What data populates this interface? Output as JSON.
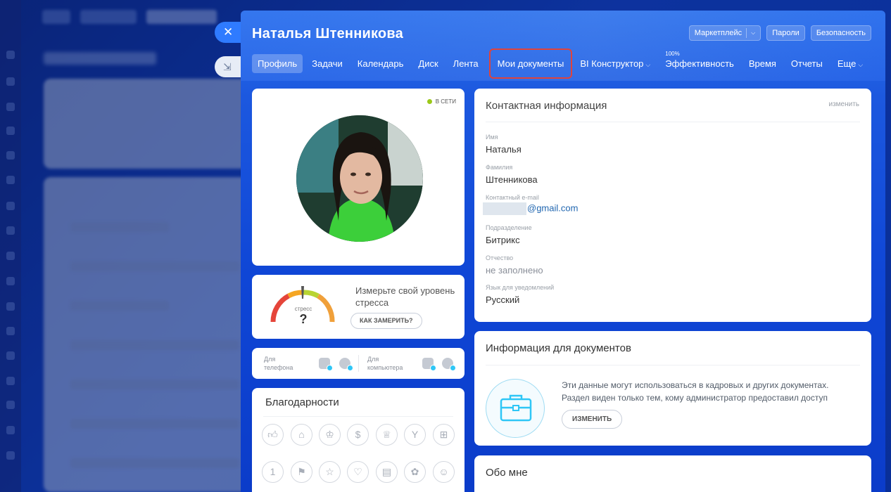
{
  "header": {
    "user_name": "Наталья Штенникова",
    "buttons": {
      "marketplace": "Маркетплейс",
      "passwords": "Пароли",
      "security": "Безопасность"
    },
    "close_icon": "✕"
  },
  "tabs": [
    {
      "label": "Профиль",
      "active": true
    },
    {
      "label": "Задачи"
    },
    {
      "label": "Календарь"
    },
    {
      "label": "Диск"
    },
    {
      "label": "Лента"
    },
    {
      "label": "Мои документы",
      "highlighted": true
    },
    {
      "label": "BI Конструктор",
      "dropdown": true
    },
    {
      "label": "Эффективность",
      "sup": "100%"
    },
    {
      "label": "Время"
    },
    {
      "label": "Отчеты"
    },
    {
      "label": "Еще",
      "dropdown": true
    }
  ],
  "profile": {
    "status": "в сети",
    "status_color": "#9bc819"
  },
  "stress": {
    "text": "Измерьте свой уровень стресса",
    "gauge_label": "стресс",
    "gauge_value": "?",
    "button": "КАК ЗАМЕРИТЬ?"
  },
  "apps": {
    "phone_label": "Для телефона",
    "desktop_label": "Для компьютера"
  },
  "thanks": {
    "title": "Благодарности"
  },
  "contact": {
    "title": "Контактная информация",
    "edit": "изменить",
    "fields": [
      {
        "label": "Имя",
        "value": "Наталья"
      },
      {
        "label": "Фамилия",
        "value": "Штенникова"
      },
      {
        "label": "Контактный e-mail",
        "value": "@gmail.com"
      },
      {
        "label": "Подразделение",
        "value": "Битрикс"
      },
      {
        "label": "Отчество",
        "value": "не заполнено"
      },
      {
        "label": "Язык для уведомлений",
        "value": "Русский"
      }
    ]
  },
  "docs": {
    "title": "Информация для документов",
    "line1": "Эти данные могут использоваться в кадровых и других документах.",
    "line2": "Раздел виден только тем, кому администратор предоставил доступ",
    "button": "ИЗМЕНИТЬ"
  },
  "about": {
    "title": "Обо мне"
  },
  "colors": {
    "accent": "#2f7bff",
    "highlight": "#e0433b",
    "info": "#2fc6f6"
  }
}
